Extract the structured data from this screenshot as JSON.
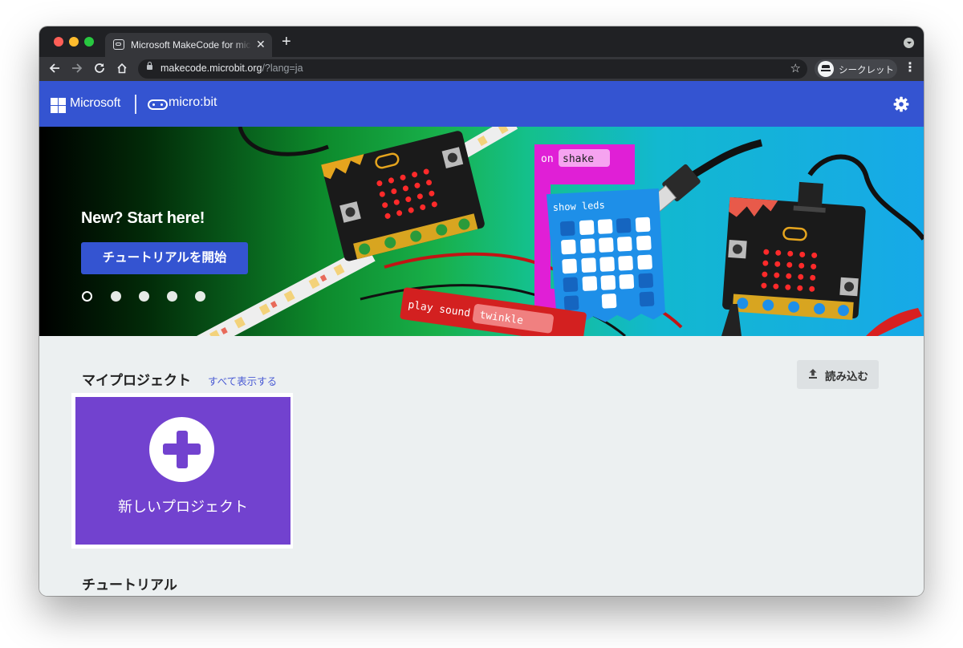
{
  "browser": {
    "tab_title": "Microsoft MakeCode for micro:bit",
    "tab_close": "✕",
    "new_tab": "+",
    "url_host": "makecode.microbit.org",
    "url_path": "/?lang=ja",
    "incognito_label": "シークレット",
    "icons": [
      "back-arrow-icon",
      "forward-arrow-icon",
      "reload-icon",
      "home-icon",
      "lock-icon",
      "star-icon",
      "incognito-icon",
      "menu-icon"
    ]
  },
  "header": {
    "microsoft_label": "Microsoft",
    "microbit_label": "micro:bit",
    "brand_color": "#3454d1"
  },
  "hero": {
    "title": "New? Start here!",
    "button_label": "チュートリアルを開始",
    "carousel_dots": 5,
    "active_dot": 1,
    "code_block_on": "on",
    "code_block_shake": "shake",
    "code_block_show_leds": "show leds",
    "code_block_play": "play sound",
    "code_block_twinkle": "twinkle"
  },
  "main": {
    "my_projects_title": "マイプロジェクト",
    "see_all_label": "すべて表示する",
    "import_label": "読み込む",
    "new_project_label": "新しいプロジェクト",
    "new_project_color": "#7242cf",
    "tutorials_title": "チュートリアル"
  }
}
